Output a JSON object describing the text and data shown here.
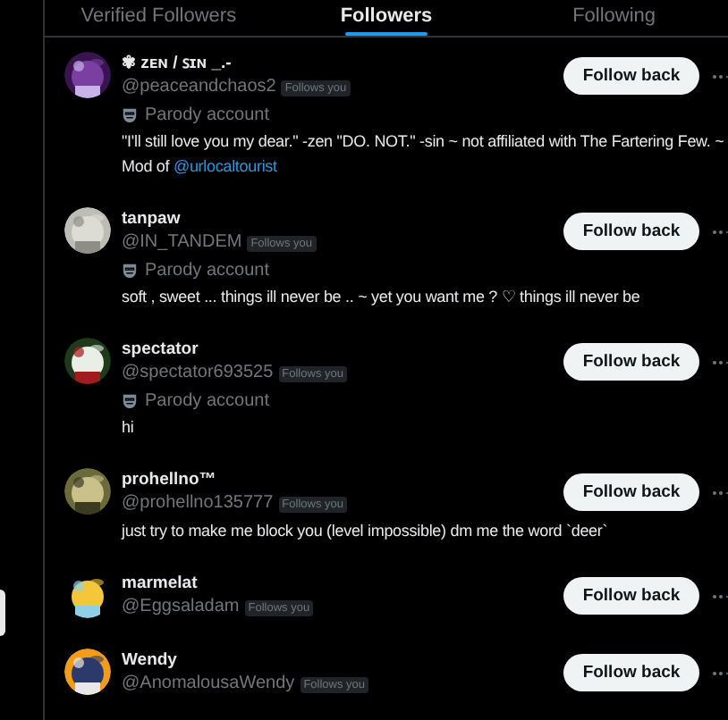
{
  "tabs": [
    {
      "label": "Verified Followers",
      "selected": false
    },
    {
      "label": "Followers",
      "selected": true
    },
    {
      "label": "Following",
      "selected": false
    }
  ],
  "followers": [
    {
      "name": "✾ ᴢᴇɴ / ꜱɪɴ _.-",
      "handle": "@peaceandchaos2",
      "badge": "Follows you",
      "parody": "Parody account",
      "bio": [
        {
          "kind": "text",
          "text": "\"I'll still love you my dear.\" -zen \"DO. NOT.\" -sin ~ not affiliated with The Fartering Few. ~ Mod of "
        },
        {
          "kind": "link",
          "text": "@urlocaltourist"
        }
      ],
      "button": "Follow back"
    },
    {
      "name": "tanpaw",
      "handle": "@IN_TANDEM",
      "badge": "Follows you",
      "parody": "Parody account",
      "bio": [
        {
          "kind": "text",
          "text": "soft , sweet ... things ill never be .. ~ yet you want me ? ♡ things ill never be"
        }
      ],
      "button": "Follow back"
    },
    {
      "name": "spectator",
      "handle": "@spectator693525",
      "badge": "Follows you",
      "parody": "Parody account",
      "bio": [
        {
          "kind": "text",
          "text": "hi"
        }
      ],
      "button": "Follow back"
    },
    {
      "name": "prohellno™",
      "handle": "@prohellno135777",
      "badge": "Follows you",
      "bio": [
        {
          "kind": "text",
          "text": "just try to make me block you (level impossible) dm me the word `deer`"
        }
      ],
      "button": "Follow back"
    },
    {
      "name": "marmelat",
      "handle": "@Eggsaladam",
      "badge": "Follows you",
      "button": "Follow back"
    },
    {
      "name": "Wendy",
      "handle": "@AnomalousaWendy",
      "badge": "Follows you",
      "button": "Follow back"
    }
  ]
}
